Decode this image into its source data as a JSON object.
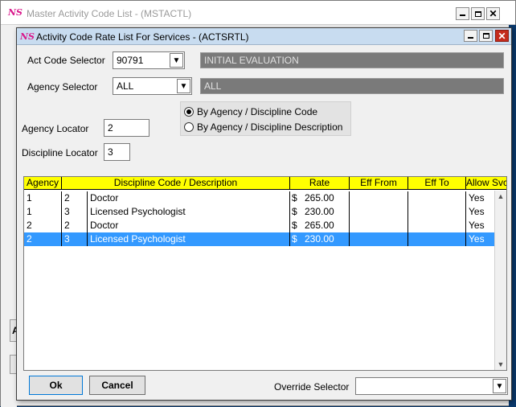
{
  "outer_window": {
    "logo": "NS",
    "title": "Master Activity Code List - (MSTACTL)",
    "stub1": "A",
    "stub2": ""
  },
  "dialog": {
    "logo": "NS",
    "title": "Activity Code Rate List For Services - (ACTSRTL)"
  },
  "form": {
    "act_code_label": "Act Code Selector",
    "act_code_value": "90791",
    "act_code_desc": "INITIAL EVALUATION",
    "agency_label": "Agency Selector",
    "agency_value": "ALL",
    "agency_desc": "ALL",
    "agency_locator_label": "Agency Locator",
    "agency_locator_value": "2",
    "discipline_locator_label": "Discipline Locator",
    "discipline_locator_value": "3",
    "radio_by_code": "By Agency / Discipline Code",
    "radio_by_desc": "By Agency / Discipline Description",
    "radio_selected": "code"
  },
  "grid": {
    "columns": [
      "Agency",
      "Discipline Code / Description",
      "Rate",
      "Eff From",
      "Eff To",
      "Allow Svc"
    ],
    "rows": [
      {
        "agency": "1",
        "code": "2",
        "desc": "Doctor",
        "currency": "$",
        "rate": "265.00",
        "eff_from": "",
        "eff_to": "",
        "allow": "Yes"
      },
      {
        "agency": "1",
        "code": "3",
        "desc": "Licensed Psychologist",
        "currency": "$",
        "rate": "230.00",
        "eff_from": "",
        "eff_to": "",
        "allow": "Yes"
      },
      {
        "agency": "2",
        "code": "2",
        "desc": "Doctor",
        "currency": "$",
        "rate": "265.00",
        "eff_from": "",
        "eff_to": "",
        "allow": "Yes"
      },
      {
        "agency": "2",
        "code": "3",
        "desc": "Licensed Psychologist",
        "currency": "$",
        "rate": "230.00",
        "eff_from": "",
        "eff_to": "",
        "allow": "Yes"
      }
    ],
    "selected_row": 3
  },
  "footer": {
    "ok_label": "Ok",
    "cancel_label": "Cancel",
    "override_label": "Override Selector",
    "override_value": ""
  },
  "icons": {
    "dropdown": "chevron-down-icon",
    "scroll_up": "scroll-up-icon",
    "scroll_down": "scroll-down-icon",
    "minimize": "minimize-icon",
    "maximize": "maximize-icon",
    "close": "close-icon"
  },
  "colors": {
    "grid_header": "#ffff00",
    "selection": "#3399ff",
    "desc_field": "#7a7a7a",
    "close_button": "#c42b1c",
    "logo": "#d91a8c"
  }
}
